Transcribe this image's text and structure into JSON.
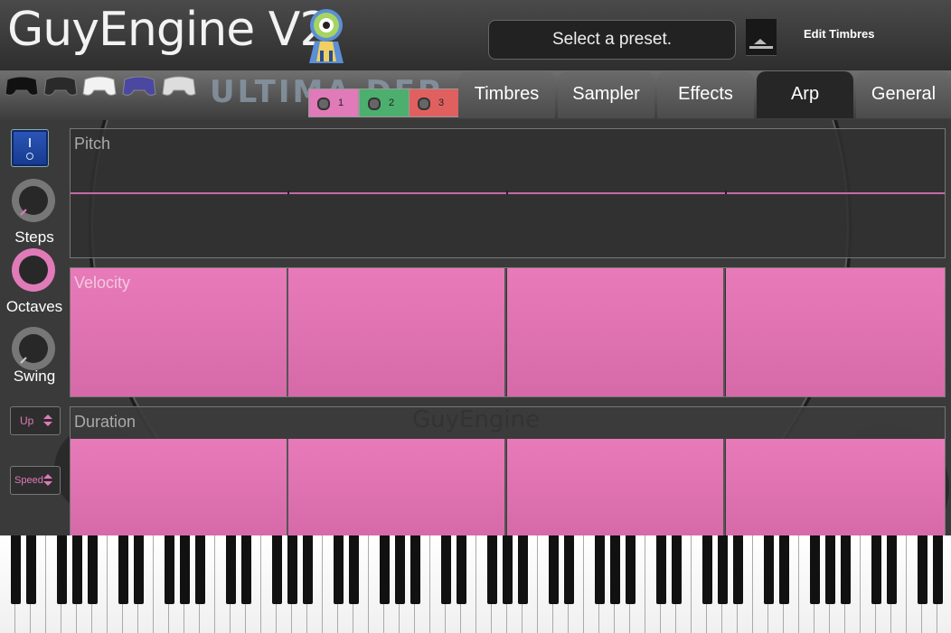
{
  "header": {
    "title": "GuyEngine V2",
    "preset_placeholder": "Select a preset.",
    "edit_timbres": "Edit Timbres"
  },
  "plugin_logo": "ULTIMA DEP",
  "slots": [
    {
      "label": "1",
      "color": "#e07ab8"
    },
    {
      "label": "2",
      "color": "#4caf6e"
    },
    {
      "label": "3",
      "color": "#e06060"
    }
  ],
  "tabs": [
    {
      "label": "Timbres",
      "active": false
    },
    {
      "label": "Sampler",
      "active": false
    },
    {
      "label": "Effects",
      "active": false
    },
    {
      "label": "Arp",
      "active": true
    },
    {
      "label": "General",
      "active": false
    }
  ],
  "arp": {
    "knobs": [
      {
        "label": "Steps"
      },
      {
        "label": "Octaves"
      },
      {
        "label": "Swing"
      }
    ],
    "direction": "Up",
    "speed": "Speed",
    "panels": {
      "pitch": "Pitch",
      "velocity": "Velocity",
      "duration": "Duration"
    },
    "step_count": 4
  },
  "watermark": "GuyEngine",
  "colors": {
    "accent": "#e07ab8",
    "panel_bg": "#333333",
    "power": "#1f4aa8"
  }
}
